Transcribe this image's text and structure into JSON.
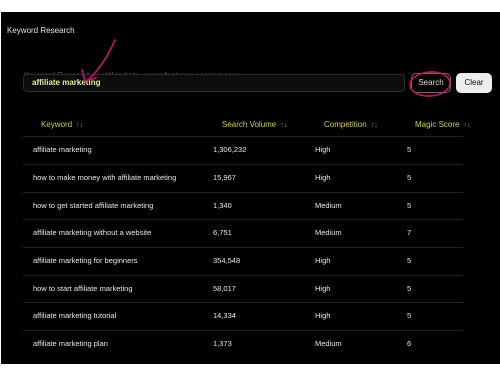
{
  "page": {
    "title": "Keyword Research"
  },
  "notice": "Keyword Research is still in beta, more features coming soon.",
  "search": {
    "value": "affiliate marketing",
    "button": "Search",
    "clear": "Clear"
  },
  "colors": {
    "panel": "#000000",
    "header": "#cfd03a",
    "annotation": "#c0146a",
    "clear_bg": "#ededed"
  },
  "table": {
    "sort_icon": "sort-arrows-icon",
    "columns": [
      "Keyword",
      "Search Volume",
      "Competition",
      "Magic Score"
    ],
    "rows": [
      [
        "affiliate marketing",
        "1,306,232",
        "High",
        "5"
      ],
      [
        "how to make money with affiliate marketing",
        "15,967",
        "High",
        "5"
      ],
      [
        "how to get started affiliate marketing",
        "1,340",
        "Medium",
        "5"
      ],
      [
        "affiliate marketing without a website",
        "6,751",
        "Medium",
        "7"
      ],
      [
        "affiliate marketing for beginners",
        "354,548",
        "High",
        "5"
      ],
      [
        "how to start affiliate marketing",
        "58,017",
        "High",
        "5"
      ],
      [
        "affiliate marketing tutorial",
        "14,334",
        "High",
        "5"
      ],
      [
        "affiliate marketing plan",
        "1,373",
        "Medium",
        "6"
      ]
    ]
  }
}
